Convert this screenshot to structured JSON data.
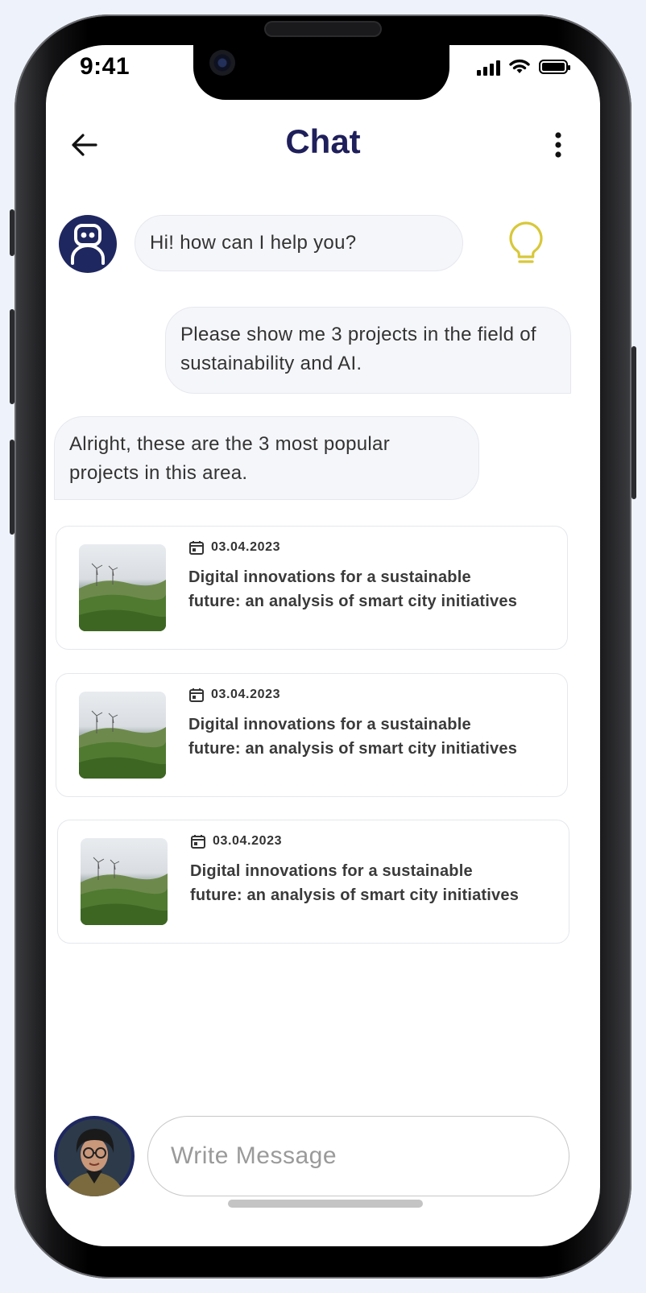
{
  "status_bar": {
    "time": "9:41"
  },
  "header": {
    "title": "Chat"
  },
  "messages": [
    {
      "sender": "bot",
      "text": "Hi! how can I help you?"
    },
    {
      "sender": "user",
      "text": "Please show me 3 projects in the field of sustainability and AI."
    },
    {
      "sender": "bot",
      "text": "Alright, these are the 3 most popular projects in this area."
    }
  ],
  "projects": [
    {
      "date": "03.04.2023",
      "title": "Digital innovations for a sustainable future: an analysis of smart city initiatives"
    },
    {
      "date": "03.04.2023",
      "title": "Digital innovations for a sustainable future: an analysis of smart city initiatives"
    },
    {
      "date": "03.04.2023",
      "title": "Digital innovations for a sustainable future: an analysis of smart city initiatives"
    }
  ],
  "composer": {
    "placeholder": "Write Message"
  },
  "colors": {
    "title": "#1f1f5b",
    "avatar_bg": "#1f2760",
    "bubble_bg": "#f5f6fa",
    "bulb": "#d8c83a"
  },
  "icons": {
    "back": "arrow-left-icon",
    "more": "more-vertical-icon",
    "bot": "robot-icon",
    "idea": "lightbulb-icon",
    "date": "calendar-icon"
  }
}
